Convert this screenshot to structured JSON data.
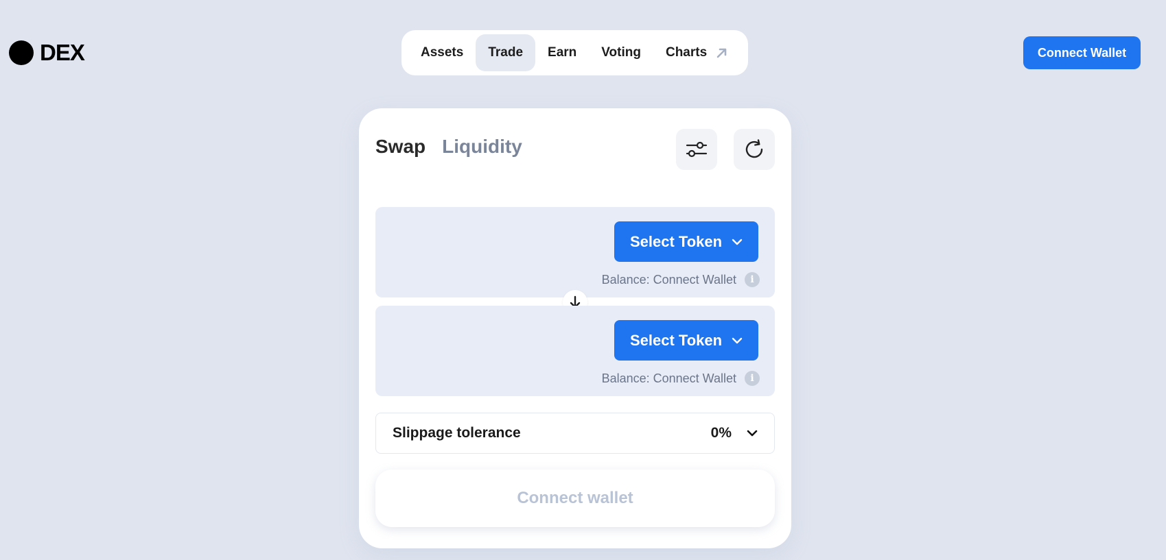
{
  "app": {
    "logo_text": "DEX"
  },
  "nav": {
    "items": [
      {
        "label": "Assets"
      },
      {
        "label": "Trade"
      },
      {
        "label": "Earn"
      },
      {
        "label": "Voting"
      },
      {
        "label": "Charts"
      }
    ],
    "active": "Trade"
  },
  "header": {
    "connect_wallet_label": "Connect Wallet"
  },
  "swap_card": {
    "tabs": [
      {
        "label": "Swap"
      },
      {
        "label": "Liquidity"
      }
    ],
    "active_tab": "Swap",
    "from": {
      "select_label": "Select Token",
      "balance_text": "Balance: Connect Wallet"
    },
    "to": {
      "select_label": "Select Token",
      "balance_text": "Balance: Connect Wallet"
    },
    "slippage": {
      "label": "Slippage tolerance",
      "value": "0%"
    },
    "connect_label": "Connect wallet"
  },
  "colors": {
    "background": "#dfe4ef",
    "accent": "#1f74f0",
    "card": "#ffffff",
    "token_box": "#e8ecf6",
    "muted_text": "#7a8599"
  }
}
